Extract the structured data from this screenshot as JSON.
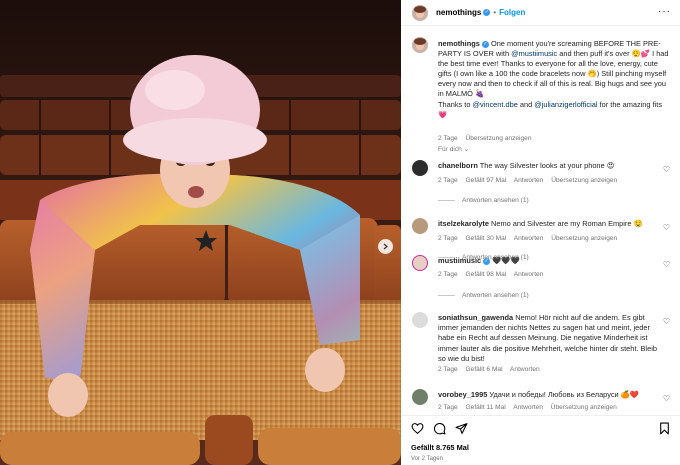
{
  "colors": {
    "accent": "#0095f6",
    "link": "#00376b",
    "muted": "#737373",
    "verified": "#3897f0"
  },
  "post": {
    "username": "nemothings",
    "follow_label": "Folgen",
    "more_icon": "more-horizontal-icon"
  },
  "caption": {
    "username": "nemothings",
    "text_1": "One moment you're screaming BEFORE THE PRE-PARTY IS OVER with ",
    "mention_1": "@mustiimusic",
    "text_2": " and then puff it's over 😮‍💨💕 I had the best time ever! Thanks to everyone for all the love, energy, cute gifts (I own like a 100 the code bracelets now 🤭) Still pinching myself every now and then to check if all of this is real. Big hugs and see you in MALMÖ 🍇",
    "text_3": "Thanks to ",
    "mention_2": "@vincent.dbe",
    "text_4": " and ",
    "mention_3": "@julianzigerlofficial",
    "text_5": " for the amazing fits 💗",
    "age": "2 Tage",
    "translate": "Übersetzung anzeigen",
    "see_translation": "Für dich"
  },
  "comments": [
    {
      "username": "chanelborn",
      "text": "The way Silvester looks at your phone 😍",
      "age": "2 Tage",
      "likes": "Gefällt 97 Mal",
      "reply": "Antworten",
      "translate": "Übersetzung anzeigen",
      "replies": "Antworten ansehen (1)"
    },
    {
      "username": "itselzekarolyte",
      "text": "Nemo and Silvester are my Roman Empire 🤤",
      "age": "2 Tage",
      "likes": "Gefällt 30 Mal",
      "reply": "Antworten",
      "translate": "Übersetzung anzeigen",
      "replies": "Antworten ansehen (1)"
    },
    {
      "username": "mustiimusic",
      "text": "🖤🖤🖤",
      "age": "2 Tage",
      "likes": "Gefällt 98 Mal",
      "reply": "Antworten",
      "replies": "Antworten ansehen (1)"
    },
    {
      "username": "soniathsun_gawenda",
      "text": "Nemo! Hör nicht auf die andern. Es gibt immer jemanden der nichts Nettes zu sagen hat und meint, jeder habe ein Recht auf dessen Meinung. Die negative Minderheit ist immer lauter als die positive Mehrheit, welche hinter dir steht. Bleib so wie du bist!",
      "age": "2 Tage",
      "likes": "Gefällt 6 Mal",
      "reply": "Antworten"
    },
    {
      "username": "vorobey_1995",
      "text": "Удачи и победы! Любовь из Беларуси 🍊❤️",
      "age": "2 Tage",
      "likes": "Gefällt 11 Mal",
      "reply": "Antworten",
      "translate": "Übersetzung anzeigen"
    }
  ],
  "footer": {
    "likes": "Gefällt 8.765 Mal",
    "time": "Vor 2 Tagen",
    "icons": [
      "heart-icon",
      "comment-icon",
      "share-icon",
      "bookmark-icon"
    ]
  }
}
